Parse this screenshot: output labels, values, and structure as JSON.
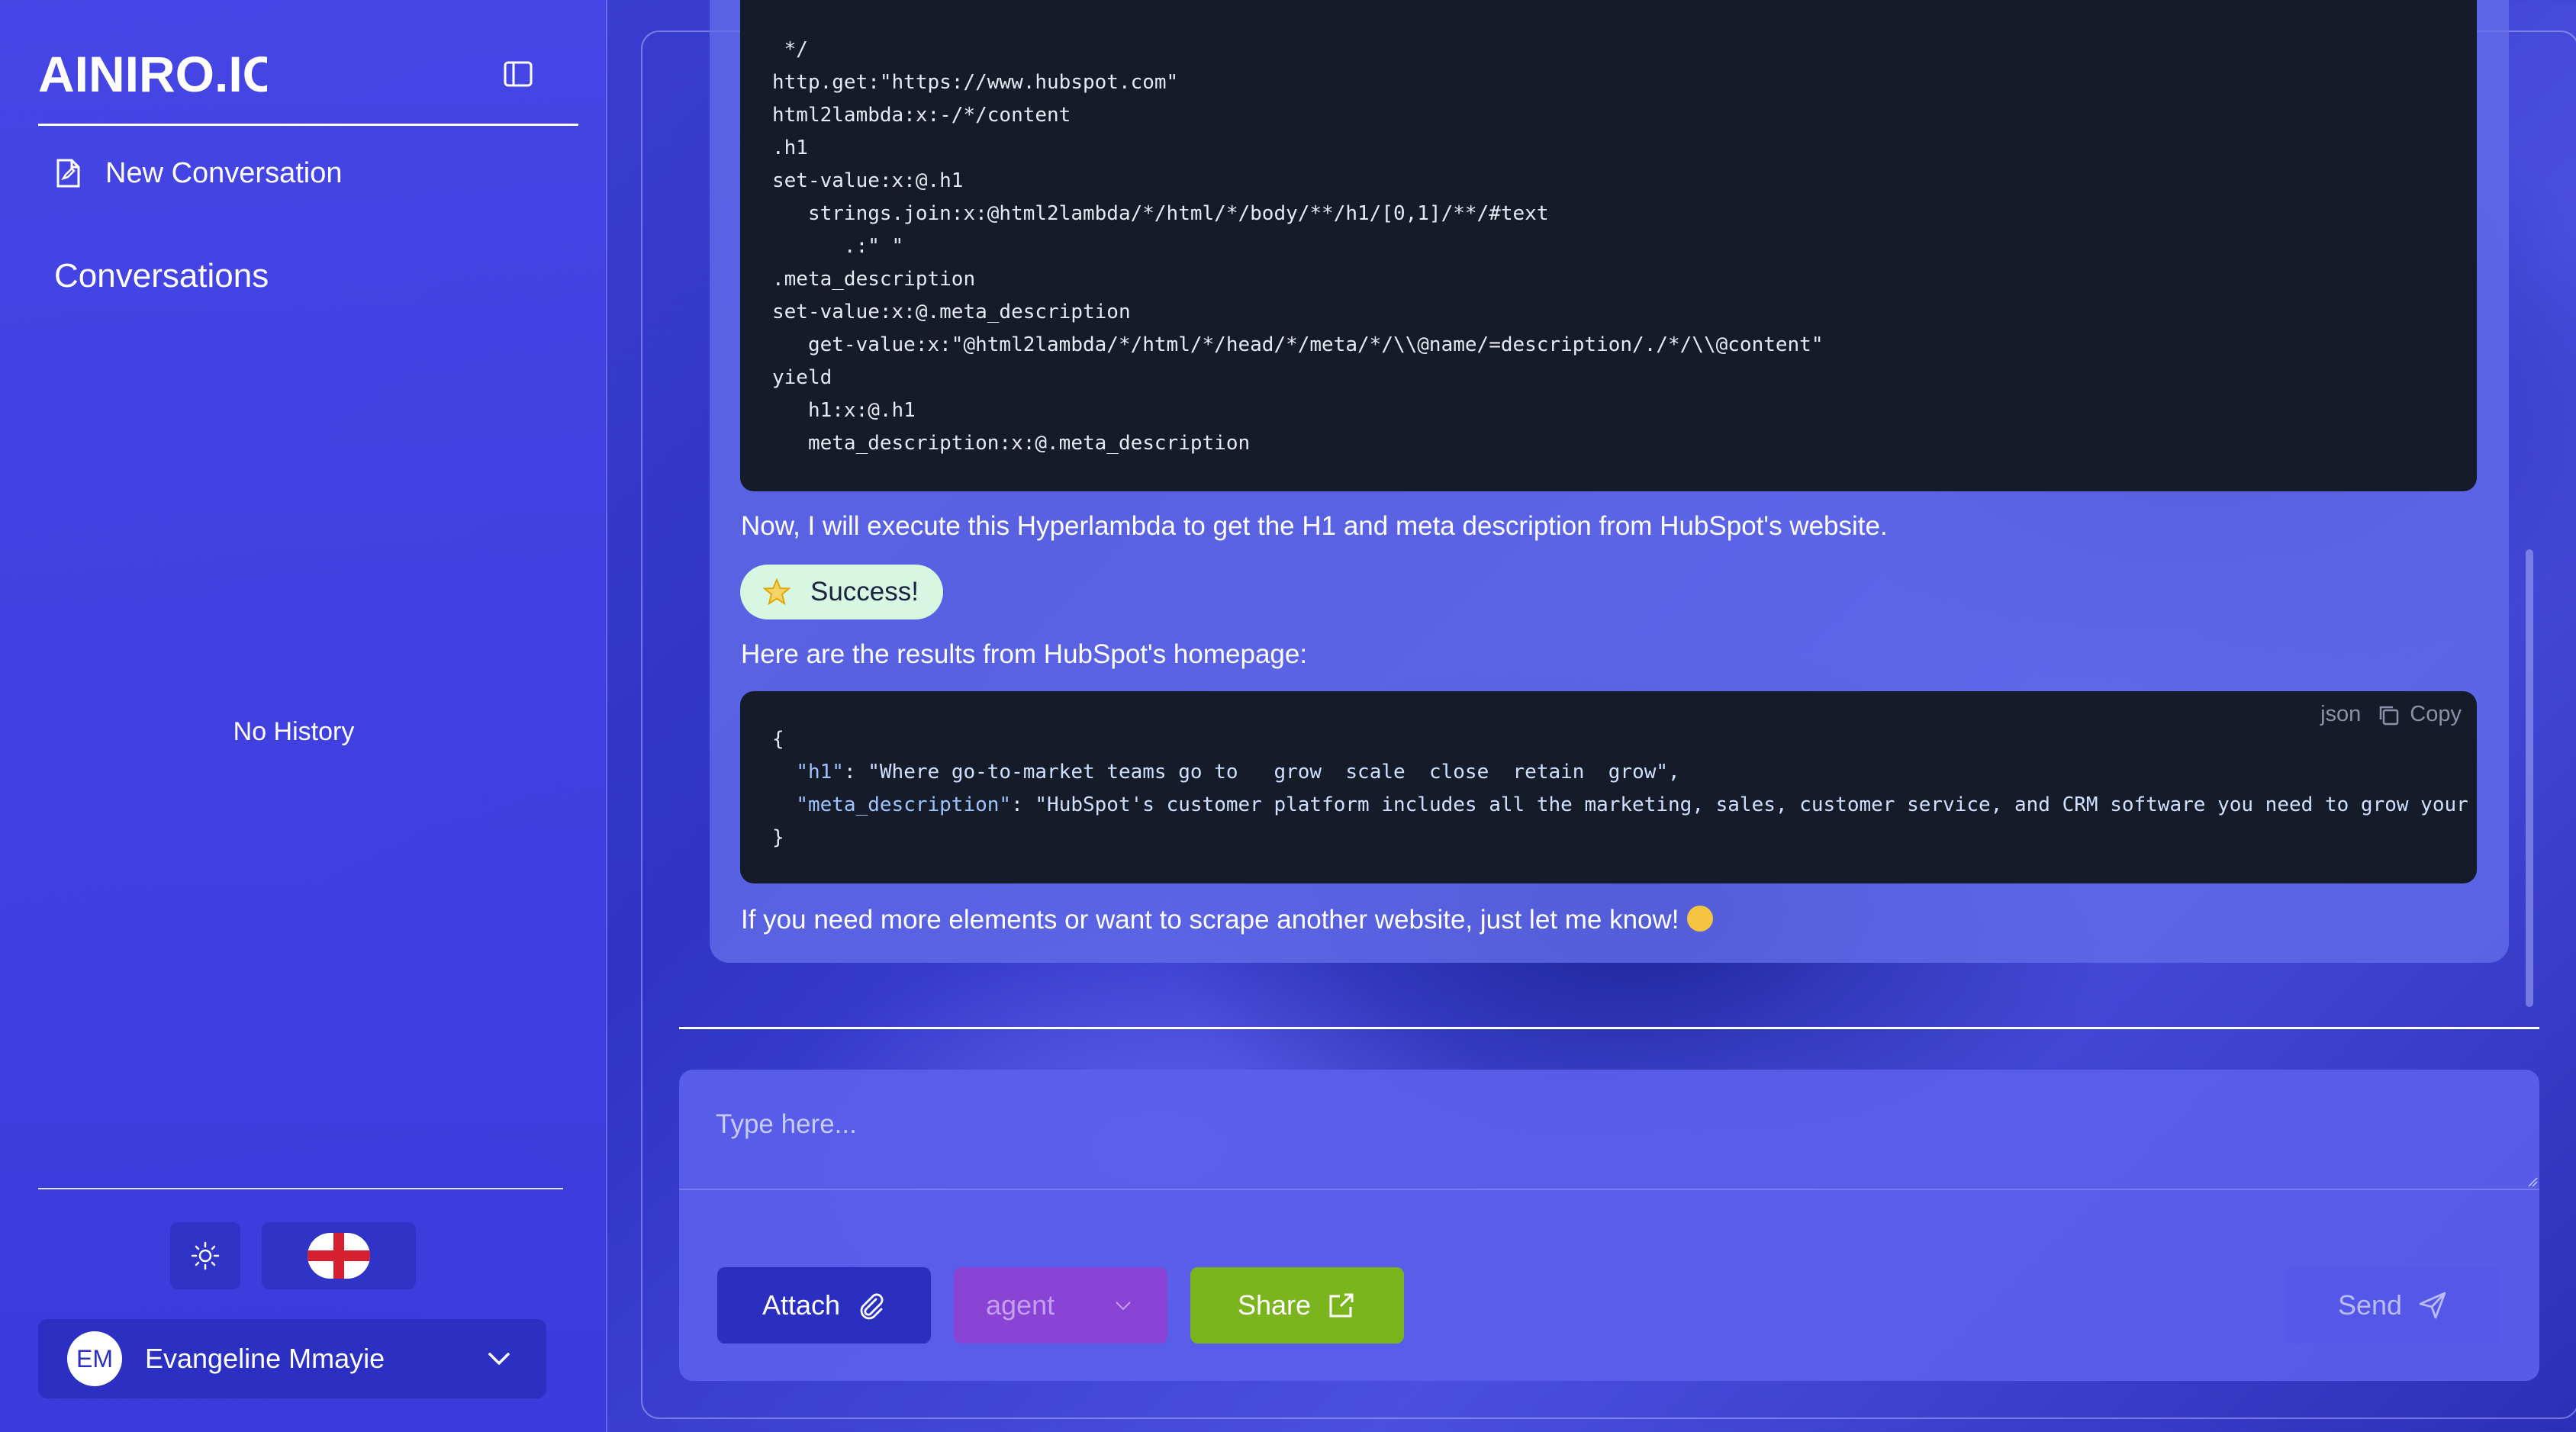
{
  "sidebar": {
    "logo_text": "AINIRO.IO",
    "new_conversation": "New Conversation",
    "conversations_heading": "Conversations",
    "no_history": "No History",
    "user": {
      "initials": "EM",
      "name": "Evangeline Mmayie"
    }
  },
  "chat": {
    "code_block_1": " */\nhttp.get:\"https://www.hubspot.com\"\nhtml2lambda:x:-/*/content\n.h1\nset-value:x:@.h1\n   strings.join:x:@html2lambda/*/html/*/body/**/h1/[0,1]/**/#text\n      .:\" \"\n.meta_description\nset-value:x:@.meta_description\n   get-value:x:\"@html2lambda/*/html/*/head/*/meta/*/\\\\@name/=description/./*/\\\\@content\"\nyield\n   h1:x:@.h1\n   meta_description:x:@.meta_description",
    "execute_text": "Now, I will execute this Hyperlambda to get the H1 and meta description from HubSpot's website.",
    "success_badge": "Success!",
    "results_text": "Here are the results from HubSpot's homepage:",
    "code_block_2": {
      "language": "json",
      "copy_label": "Copy",
      "open": "{",
      "h1_key": "\"h1\"",
      "h1_value": "\"Where go-to-market teams go to   grow  scale  close  retain  grow\",",
      "meta_key": "\"meta_description\"",
      "meta_value": "\"HubSpot's customer platform includes all the marketing, sales, customer service, and CRM software you need to grow your",
      "close": "}"
    },
    "closing_text": "If you need more elements or want to scrape another website, just let me know!"
  },
  "composer": {
    "placeholder": "Type here...",
    "attach_label": "Attach",
    "agent_value": "agent",
    "share_label": "Share",
    "send_label": "Send"
  },
  "colors": {
    "accent": "#2a2fc0",
    "share": "#7bb51e",
    "agent": "#8944d6",
    "success_bg": "#d8f7e3"
  }
}
